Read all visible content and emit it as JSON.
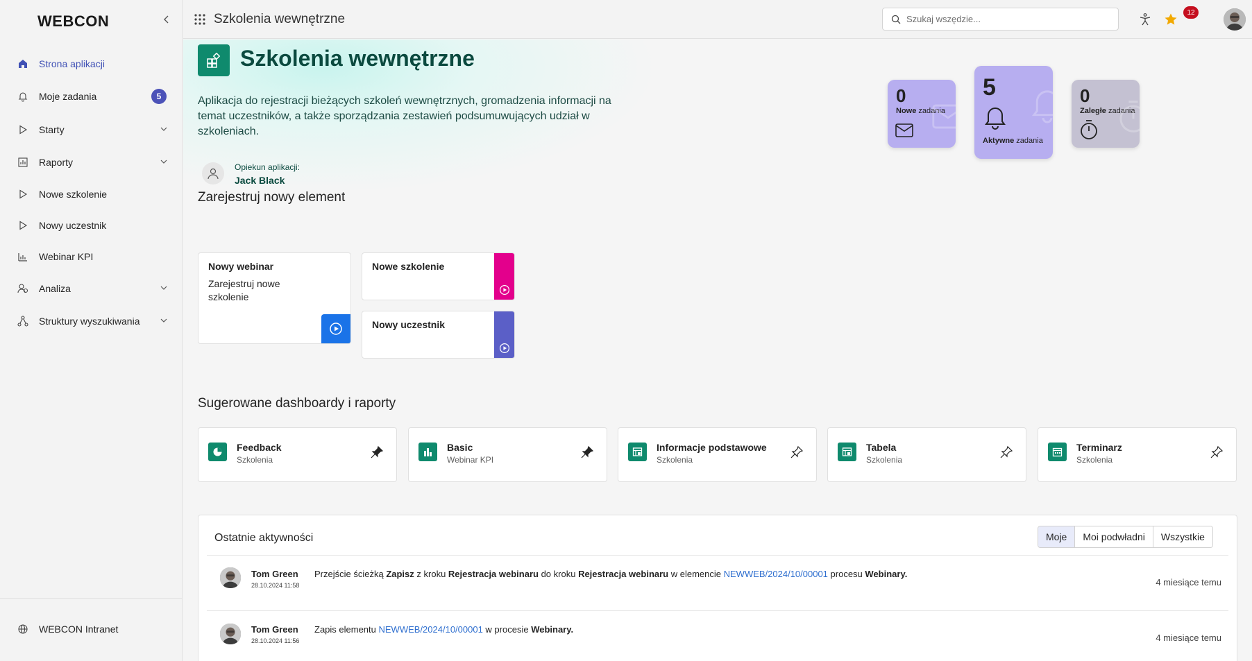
{
  "brand": {
    "logo_text": "WEBCON"
  },
  "colors": {
    "accent": "#4c52b8",
    "brand_green": "#0f8a6d",
    "pink": "#e3008c",
    "purple": "#5b5fc7",
    "blue": "#1a73e8",
    "notification_red": "#c50f1f"
  },
  "sidebar": {
    "items": [
      {
        "label": "Strona aplikacji",
        "icon": "home-icon",
        "active": true
      },
      {
        "label": "Moje zadania",
        "icon": "bell-icon",
        "badge": "5"
      },
      {
        "label": "Starty",
        "icon": "play-icon",
        "expandable": true
      },
      {
        "label": "Raporty",
        "icon": "report-icon",
        "expandable": true
      },
      {
        "label": "Nowe szkolenie",
        "icon": "play-icon"
      },
      {
        "label": "Nowy uczestnik",
        "icon": "play-icon"
      },
      {
        "label": "Webinar KPI",
        "icon": "dashboard-icon"
      },
      {
        "label": "Analiza",
        "icon": "analysis-icon",
        "expandable": true
      },
      {
        "label": "Struktury wyszukiwania",
        "icon": "structure-icon",
        "expandable": true
      }
    ],
    "footer": {
      "label": "WEBCON Intranet",
      "icon": "globe-icon"
    }
  },
  "topbar": {
    "title": "Szkolenia wewnętrzne",
    "search_placeholder": "Szukaj wszędzie...",
    "notification_count": "12"
  },
  "hero": {
    "title": "Szkolenia wewnętrzne",
    "description": "Aplikacja do rejestracji bieżących szkoleń wewnętrznych, gromadzenia informacji na temat uczestników, a także sporządzania zestawień podsumuwujących udział w szkoleniach.",
    "owner_label": "Opiekun aplikacji:",
    "owner_name": "Jack Black"
  },
  "task_cards": [
    {
      "count": "0",
      "bold": "Nowe",
      "rest": " zadania",
      "icon": "envelope-icon"
    },
    {
      "count": "5",
      "bold": "Aktywne",
      "rest": " zadania",
      "icon": "bell-icon"
    },
    {
      "count": "0",
      "bold": "Zaległe",
      "rest": " zadania",
      "icon": "stopwatch-icon"
    }
  ],
  "register": {
    "title": "Zarejestruj nowy element",
    "cards": [
      {
        "title": "Nowy webinar",
        "description": "Zarejestruj nowe szkolenie",
        "color": "#1a73e8"
      },
      {
        "title": "Nowe szkolenie",
        "description": "",
        "color": "#e3008c"
      },
      {
        "title": "Nowy uczestnik",
        "description": "",
        "color": "#5b5fc7"
      }
    ]
  },
  "dashboards": {
    "title": "Sugerowane dashboardy i raporty",
    "items": [
      {
        "name": "Feedback",
        "subtitle": "Szkolenia",
        "pinned": true
      },
      {
        "name": "Basic",
        "subtitle": "Webinar KPI",
        "pinned": true
      },
      {
        "name": "Informacje podstawowe",
        "subtitle": "Szkolenia",
        "pinned": false
      },
      {
        "name": "Tabela",
        "subtitle": "Szkolenia",
        "pinned": false
      },
      {
        "name": "Terminarz",
        "subtitle": "Szkolenia",
        "pinned": false
      }
    ]
  },
  "activity": {
    "title": "Ostatnie aktywności",
    "filters": [
      "Moje",
      "Moi podwładni",
      "Wszystkie"
    ],
    "selected_filter": "Moje",
    "rows": [
      {
        "user": "Tom Green",
        "date": "28.10.2024 11:58",
        "parts": [
          "Przejście ścieżką ",
          "Zapisz",
          " z kroku ",
          "Rejestracja webinaru",
          " do kroku ",
          "Rejestracja webinaru",
          " w elemencie ",
          "NEWWEB/2024/10/00001",
          " procesu ",
          "Webinary."
        ],
        "time_ago": "4 miesiące temu"
      },
      {
        "user": "Tom Green",
        "date": "28.10.2024 11:56",
        "parts": [
          "Zapis elementu ",
          "NEWWEB/2024/10/00001",
          " w procesie ",
          "Webinary."
        ],
        "time_ago": "4 miesiące temu"
      }
    ]
  }
}
